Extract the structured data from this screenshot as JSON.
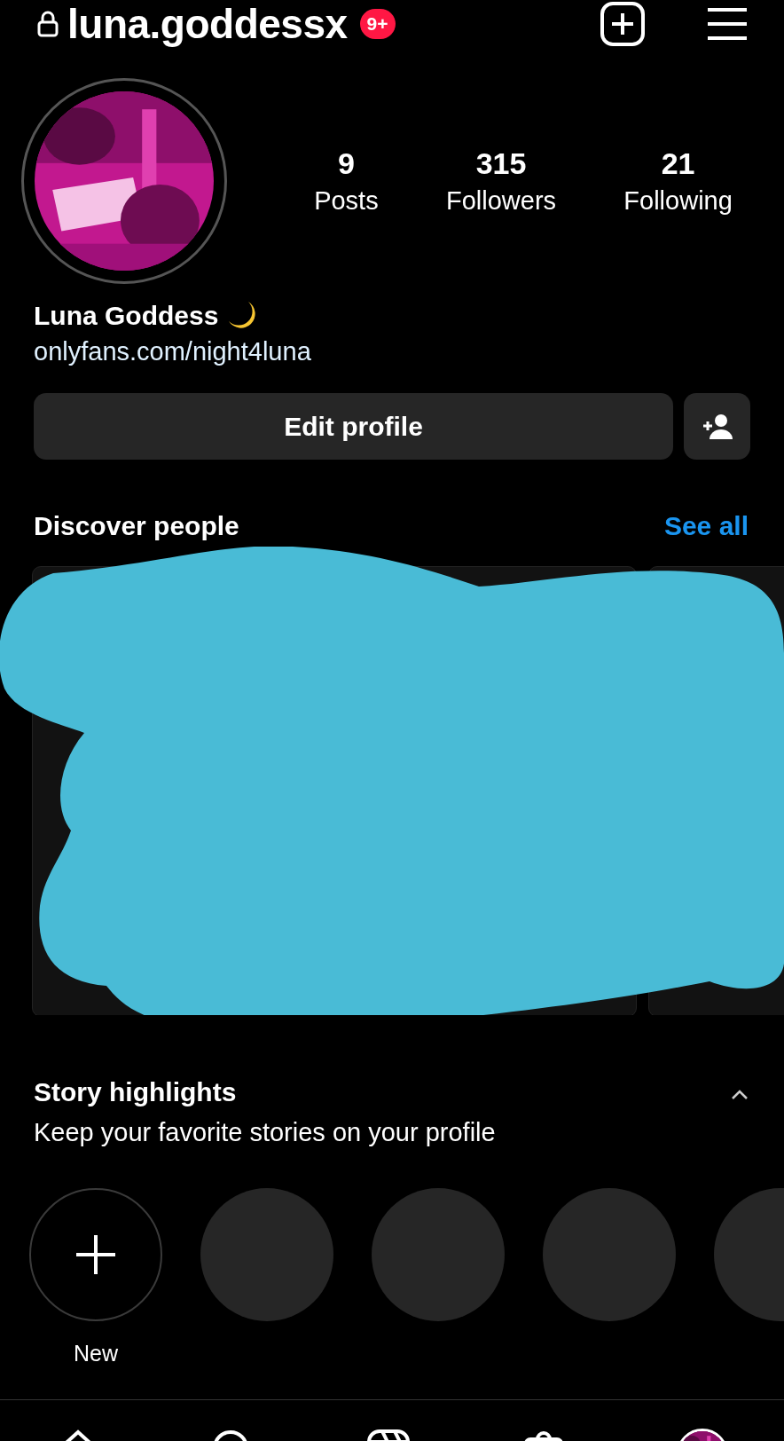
{
  "header": {
    "username": "luna.goddessx",
    "notification_badge": "9+"
  },
  "profile": {
    "stats": [
      {
        "value": "9",
        "label": "Posts"
      },
      {
        "value": "315",
        "label": "Followers"
      },
      {
        "value": "21",
        "label": "Following"
      }
    ],
    "name": "Luna Goddess",
    "link": "onlyfans.com/night4luna"
  },
  "actions": {
    "edit_button": "Edit profile"
  },
  "discover": {
    "title": "Discover people",
    "see_all": "See all"
  },
  "highlights": {
    "title": "Story highlights",
    "subtitle": "Keep your favorite stories on your profile",
    "expanded": true,
    "items": [
      {
        "kind": "new",
        "label": "New"
      },
      {
        "kind": "placeholder"
      },
      {
        "kind": "placeholder"
      },
      {
        "kind": "placeholder"
      },
      {
        "kind": "placeholder"
      }
    ]
  },
  "bottom_nav": [
    {
      "kind": "home"
    },
    {
      "kind": "search"
    },
    {
      "kind": "reels"
    },
    {
      "kind": "shop"
    },
    {
      "kind": "profile"
    }
  ]
}
